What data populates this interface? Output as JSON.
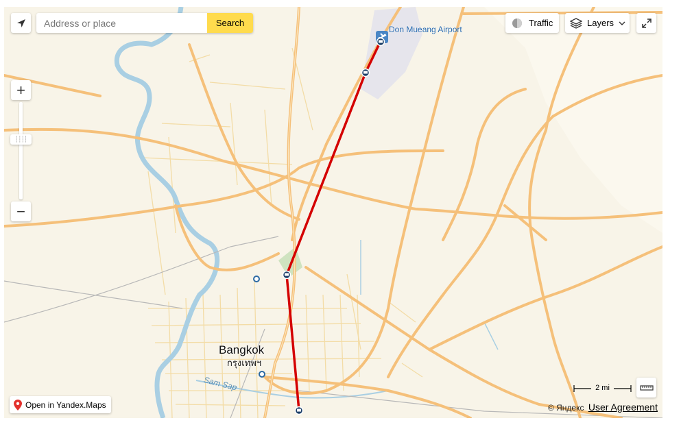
{
  "search": {
    "placeholder": "Address or place",
    "button_label": "Search"
  },
  "controls": {
    "traffic_label": "Traffic",
    "layers_label": "Layers",
    "zoom_in_label": "+",
    "zoom_out_label": "−",
    "open_in_label": "Open in Yandex.Maps"
  },
  "map": {
    "city_name": "Bangkok",
    "city_name_local": "กรุงเทพฯ",
    "airport_name": "Don Mueang Airport",
    "river_name": "Sam Sap"
  },
  "scale": {
    "label": "2 mi"
  },
  "footer": {
    "copyright": "© Яндекс",
    "user_agreement": "User Agreement"
  },
  "colors": {
    "route": "#d40000",
    "major_road": "#f5c07a",
    "minor_road": "#f3dca6",
    "water": "#a9cfe3",
    "background": "#f8f4e8",
    "search_button": "#ffdb4d"
  },
  "icons": [
    "geolocation-icon",
    "traffic-icon",
    "layers-icon",
    "chevron-down-icon",
    "fullscreen-icon",
    "ruler-icon",
    "location-pin-icon",
    "airport-icon",
    "station-icon"
  ]
}
